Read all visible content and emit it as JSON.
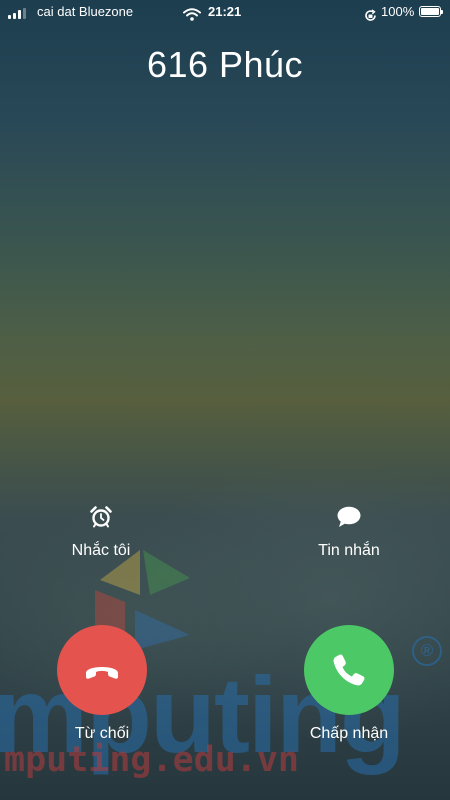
{
  "status_bar": {
    "carrier": "cai dat Bluezone",
    "time": "21:21",
    "battery_percent": "100%",
    "signal_bars": 3,
    "battery_level": 1.0,
    "icons": [
      "signal-icon",
      "wifi-icon",
      "orientation-lock-icon",
      "battery-icon"
    ]
  },
  "caller": {
    "name": "616 Phúc"
  },
  "actions": {
    "remind_label": "Nhắc tôi",
    "remind_icon": "alarm-clock-icon",
    "message_label": "Tin nhắn",
    "message_icon": "speech-bubble-icon"
  },
  "buttons": {
    "decline_label": "Từ chối",
    "decline_icon": "hang-up-phone-icon",
    "decline_color": "#e5534e",
    "accept_label": "Chấp nhận",
    "accept_icon": "phone-icon",
    "accept_color": "#4cc866"
  },
  "watermark": {
    "logo_text": "mputing",
    "url_text": "mputing.edu.vn",
    "registered_mark": "®"
  }
}
